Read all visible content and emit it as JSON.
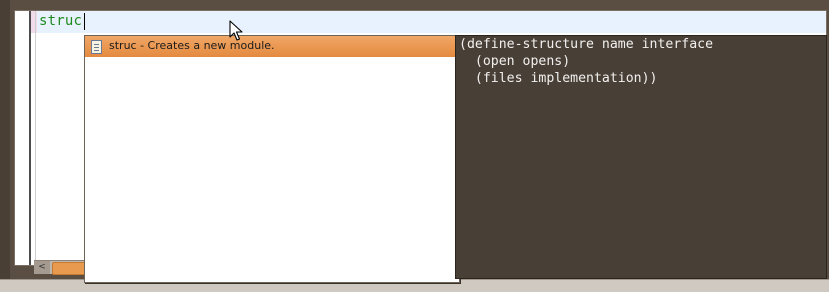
{
  "editor": {
    "typed_text": "struc"
  },
  "completion": {
    "items": [
      {
        "label": "struc  - Creates a new module."
      }
    ]
  },
  "doc_popup": {
    "code": "(define-structure name interface\n  (open opens)\n  (files implementation))"
  },
  "scrollbar": {
    "left_arrow": "<"
  },
  "colors": {
    "selection": "#e8913f",
    "doc_background": "#483f37",
    "code_text": "#1f8a1f"
  },
  "icons": [
    "document-icon",
    "mouse-pointer-icon",
    "scroll-left-arrow-icon"
  ]
}
